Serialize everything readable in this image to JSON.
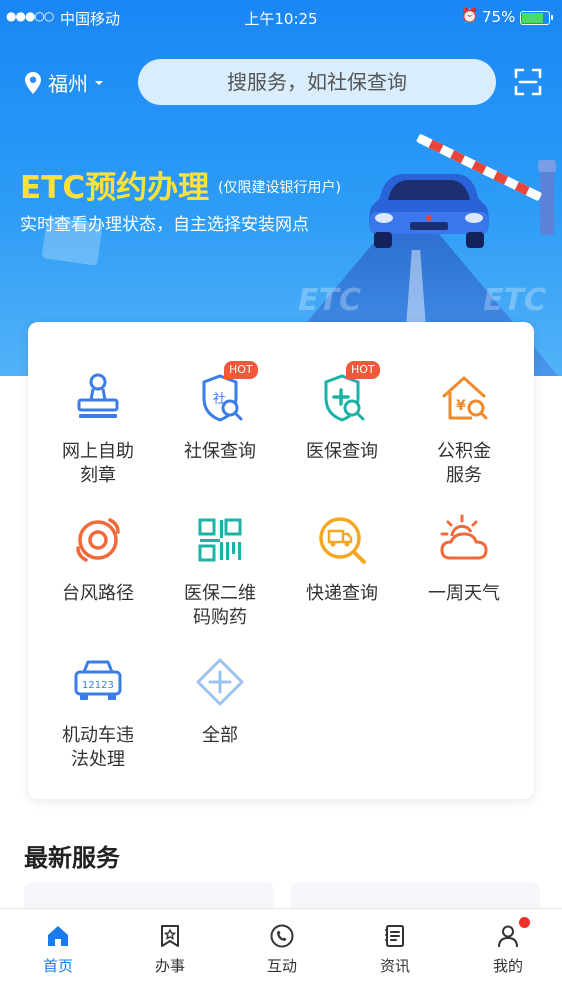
{
  "status_bar": {
    "signal": "●●●○○",
    "carrier": "中国移动",
    "time": "上午10:25",
    "battery": "75%",
    "battery_level": 0.75
  },
  "header": {
    "city": "福州",
    "search_placeholder": "搜服务，如社保查询"
  },
  "banner": {
    "title": "ETC预约办理",
    "note": "(仅限建设银行用户)",
    "subtitle": "实时查看办理状态，自主选择安装网点",
    "road_mark_left": "ETC",
    "road_mark_right": "ETC"
  },
  "services": [
    {
      "label": "网上自助\n刻章",
      "icon": "stamp-icon"
    },
    {
      "label": "社保查询",
      "icon": "social-security-icon",
      "badge": "HOT"
    },
    {
      "label": "医保查询",
      "icon": "medical-insurance-icon",
      "badge": "HOT"
    },
    {
      "label": "公积金\n服务",
      "icon": "housing-fund-icon"
    },
    {
      "label": "台风路径",
      "icon": "typhoon-icon"
    },
    {
      "label": "医保二维\n码购药",
      "icon": "qr-code-icon"
    },
    {
      "label": "快递查询",
      "icon": "express-icon"
    },
    {
      "label": "一周天气",
      "icon": "weather-icon"
    },
    {
      "label": "机动车违\n法处理",
      "icon": "vehicle-icon",
      "plate": "12123"
    },
    {
      "label": "全部",
      "icon": "all-services-icon"
    }
  ],
  "latest": {
    "title": "最新服务"
  },
  "tabs": [
    {
      "label": "首页",
      "icon": "home-icon",
      "active": true
    },
    {
      "label": "办事",
      "icon": "tasks-icon"
    },
    {
      "label": "互动",
      "icon": "interaction-icon"
    },
    {
      "label": "资讯",
      "icon": "news-icon"
    },
    {
      "label": "我的",
      "icon": "profile-icon"
    }
  ],
  "colors": {
    "primary": "#1a7bef",
    "banner_title": "#ffe13a",
    "hot": "#f2593b",
    "icon_blue": "#3b7de8",
    "icon_teal": "#1bb3a6",
    "icon_orange": "#f08a2b"
  }
}
